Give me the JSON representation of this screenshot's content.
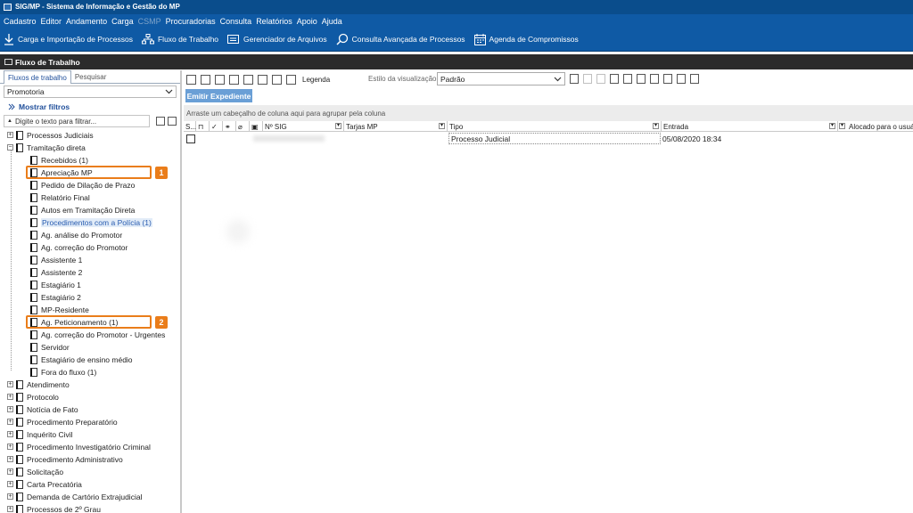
{
  "window": {
    "title": "SIG/MP - Sistema de Informação e Gestão do MP"
  },
  "menu": [
    "Cadastro",
    "Editor",
    "Andamento",
    "Carga",
    "CSMP",
    "Procuradorias",
    "Consulta",
    "Relatórios",
    "Apoio",
    "Ajuda"
  ],
  "toolbar": {
    "carga": "Carga e Importação de Processos",
    "fluxo": "Fluxo de Trabalho",
    "arquivos": "Gerenciador de Arquivos",
    "consulta": "Consulta Avançada de Processos",
    "agenda": "Agenda de Compromissos"
  },
  "section": {
    "title": "Fluxo de Trabalho"
  },
  "left": {
    "tabs": [
      "Fluxos de trabalho",
      "Pesquisar"
    ],
    "scope": "Promotoria",
    "show_filters": "Mostrar filtros",
    "filter_placeholder": "Digite o texto para filtrar..."
  },
  "tree": {
    "processos_judiciais": "Processos Judiciais",
    "tramitacao_direta": "Tramitação direta",
    "children": [
      "Recebidos (1)",
      "Apreciação MP",
      "Pedido de Dilação de Prazo",
      "Relatório Final",
      "Autos em Tramitação Direta",
      "Procedimentos com a Polícia (1)",
      "Ag. análise do Promotor",
      "Ag. correção do Promotor",
      "Assistente 1",
      "Assistente 2",
      "Estagiário 1",
      "Estagiário 2",
      "MP-Residente",
      "Ag. Peticionamento (1)",
      "Ag. correção do Promotor - Urgentes",
      "Servidor",
      "Estagiário de ensino médio",
      "Fora do fluxo (1)"
    ],
    "roots": [
      "Atendimento",
      "Protocolo",
      "Notícia de Fato",
      "Procedimento Preparatório",
      "Inquérito Civil",
      "Procedimento Investigatório Criminal",
      "Procedimento Administrativo",
      "Solicitação",
      "Carta Precatória",
      "Demanda de Cartório Extrajudicial",
      "Processos de 2º Grau"
    ]
  },
  "callouts": [
    "1",
    "2"
  ],
  "right": {
    "legend": "Legenda",
    "style_label": "Estilo da visualização",
    "style_value": "Padrão",
    "emit_button": "Emitir Expediente",
    "group_hint": "Arraste um cabeçalho de coluna aqui para agrupar pela coluna",
    "columns": [
      "S...",
      "Nº SIG",
      "Tarjas MP",
      "Tipo",
      "Entrada",
      "Alocado para o usuário"
    ],
    "rows": [
      {
        "tipo": "Processo Judicial",
        "entrada": "05/08/2020 18:34"
      }
    ]
  },
  "colors": {
    "header_blue": "#0f5aa5",
    "callout_orange": "#ea7d1a",
    "emit_button": "#6a9fd6"
  }
}
